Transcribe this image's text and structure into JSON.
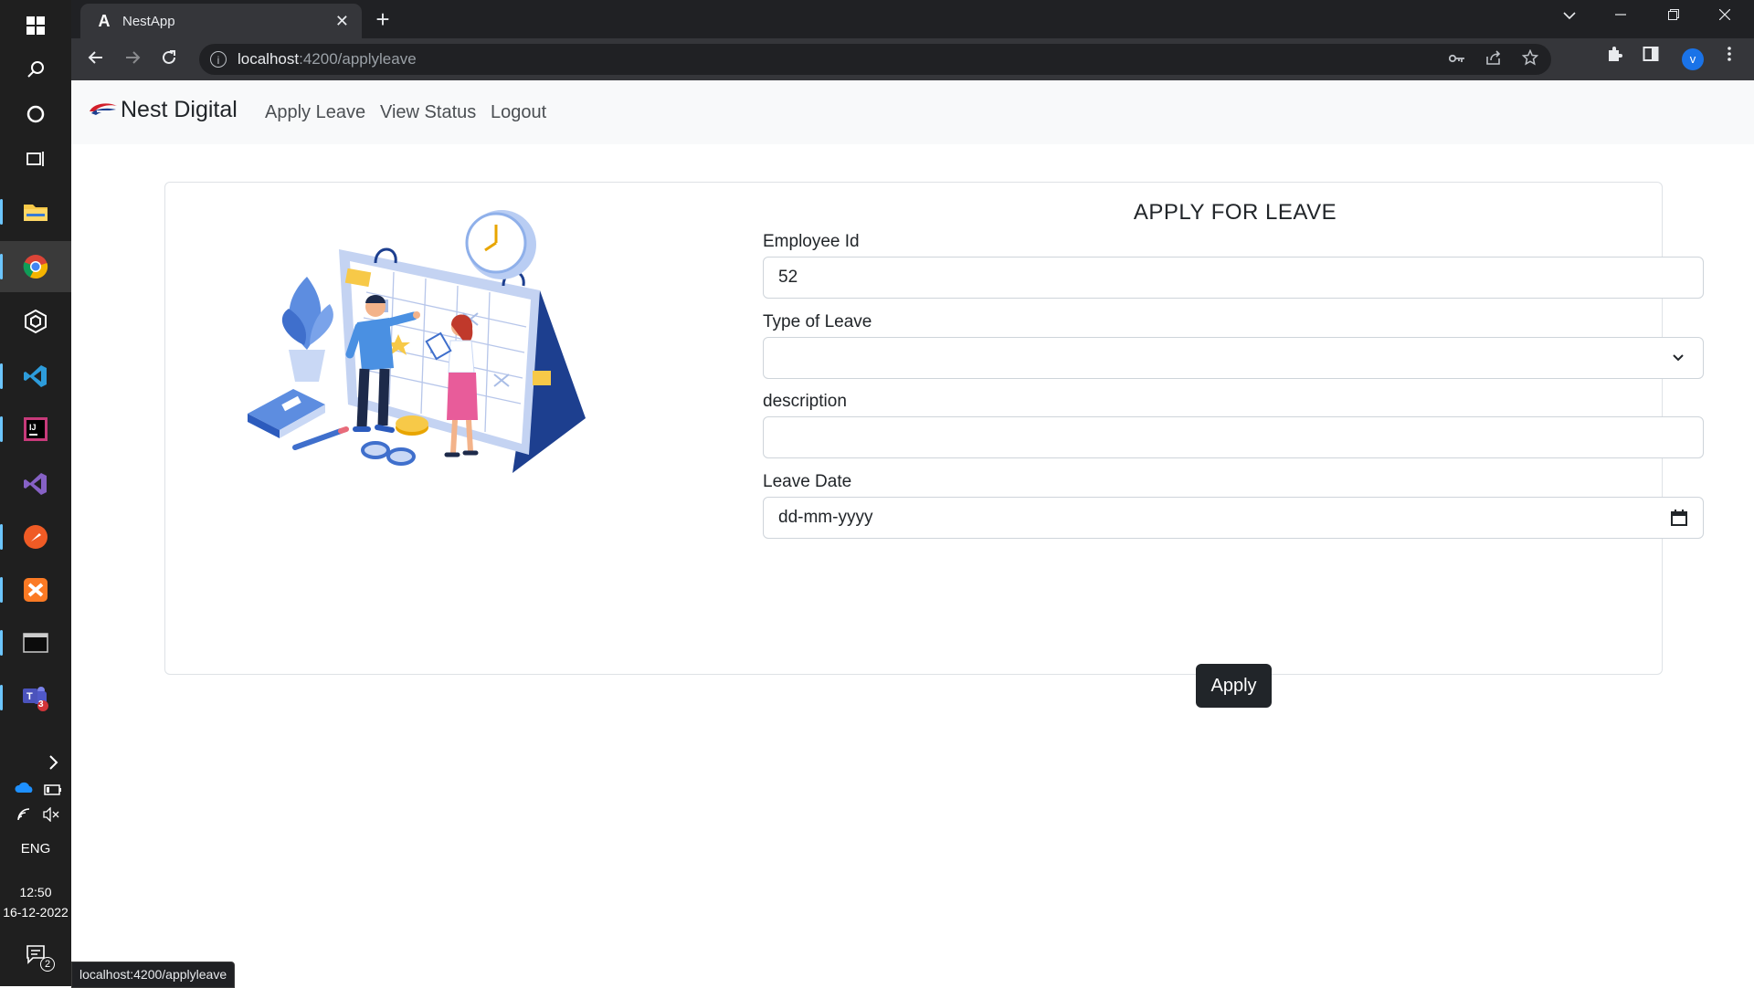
{
  "browser": {
    "tab_title": "NestApp",
    "tab_favicon": "A",
    "url_host": "localhost",
    "url_path": ":4200/applyleave",
    "profile_initial": "v"
  },
  "navbar": {
    "brand": "Nest Digital",
    "links": [
      "Apply Leave",
      "View Status",
      "Logout"
    ]
  },
  "form": {
    "title": "APPLY FOR LEAVE",
    "employee_id_label": "Employee Id",
    "employee_id_value": "52",
    "leave_type_label": "Type of Leave",
    "leave_type_value": "",
    "description_label": "description",
    "description_value": "",
    "leave_date_label": "Leave Date",
    "leave_date_placeholder": "dd-mm-yyyy",
    "apply_label": "Apply"
  },
  "taskbar": {
    "language": "ENG",
    "time": "12:50",
    "date": "16-12-2022",
    "notification_count": "2",
    "teams_badge": "3"
  },
  "status_url": "localhost:4200/applyleave",
  "colors": {
    "accent_dark": "#212529",
    "navbar_bg": "#f8f9fa",
    "chrome_bg": "#202124"
  }
}
